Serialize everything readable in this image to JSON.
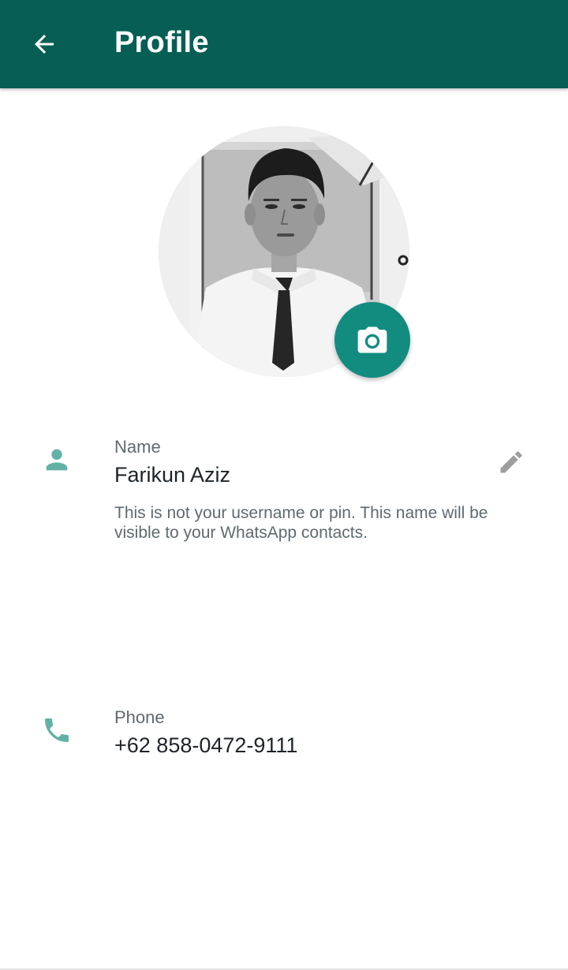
{
  "appbar": {
    "title": "Profile",
    "back_icon": "arrow-back-icon"
  },
  "profile": {
    "avatar_alt": "profile-photo",
    "camera_icon": "camera-icon"
  },
  "name_section": {
    "icon": "person-icon",
    "label": "Name",
    "value": "Farikun Aziz",
    "hint": "This is not your username or pin. This name will be visible to your WhatsApp contacts.",
    "edit_icon": "pencil-icon"
  },
  "phone_section": {
    "icon": "phone-icon",
    "label": "Phone",
    "value": "+62 858-0472-9111"
  },
  "colors": {
    "appbar": "#075e54",
    "accent": "#128c7e",
    "icon_teal": "#62b1a6",
    "edit_grey": "#9e9e9e"
  }
}
